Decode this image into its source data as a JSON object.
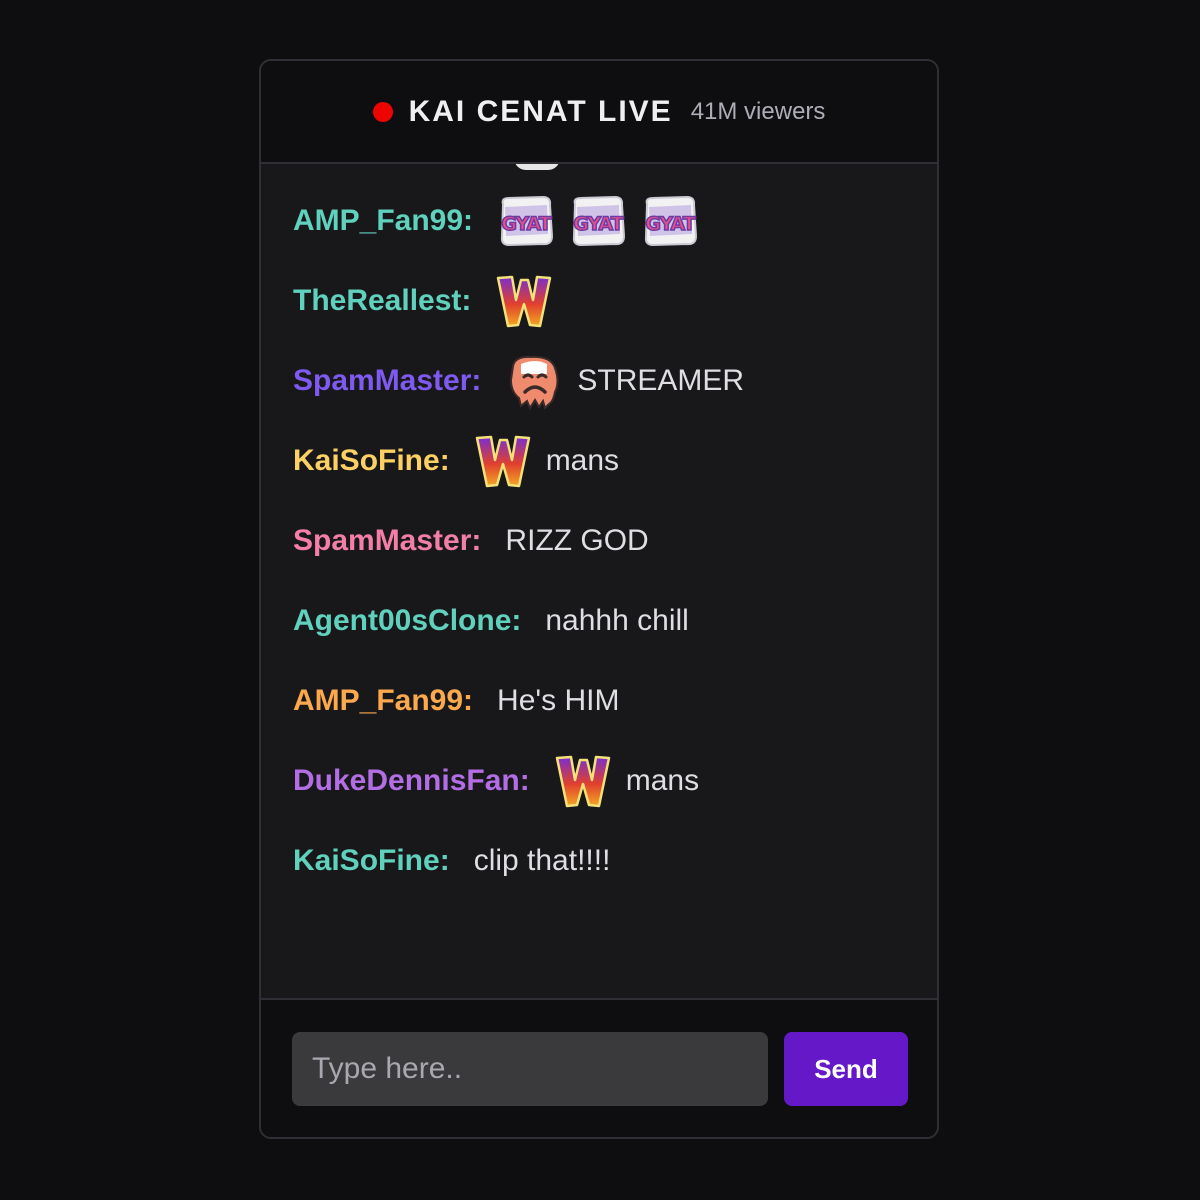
{
  "header": {
    "title": "KAI CENAT LIVE",
    "viewers": "41M viewers",
    "live_dot_color": "#eb0400"
  },
  "messages": [
    {
      "user": "AMP_Fan99:",
      "color": "#5fd1bd",
      "emotes": [
        "gyat-emote",
        "gyat-emote",
        "gyat-emote"
      ],
      "text": ""
    },
    {
      "user": "TheReallest:",
      "color": "#5fd1bd",
      "emotes": [
        "w-emote"
      ],
      "text": ""
    },
    {
      "user": "SpamMaster:",
      "color": "#7f5af0",
      "emotes": [
        "sad-face-emote"
      ],
      "text": "STREAMER"
    },
    {
      "user": "KaiSoFine:",
      "color": "#fcd062",
      "emotes": [
        "w-emote"
      ],
      "text": "mans"
    },
    {
      "user": "SpamMaster:",
      "color": "#f47fa6",
      "emotes": [],
      "text": "RIZZ GOD"
    },
    {
      "user": "Agent00sClone:",
      "color": "#5fd1bd",
      "emotes": [],
      "text": "nahhh chill"
    },
    {
      "user": "AMP_Fan99:",
      "color": "#fba94c",
      "emotes": [],
      "text": "He's HIM"
    },
    {
      "user": "DukeDennisFan:",
      "color": "#b36ee6",
      "emotes": [
        "w-emote"
      ],
      "text": "mans"
    },
    {
      "user": "KaiSoFine:",
      "color": "#5fd1bd",
      "emotes": [],
      "text": "clip that!!!!"
    }
  ],
  "input": {
    "placeholder": "Type here..",
    "value": ""
  },
  "send_button": {
    "label": "Send",
    "color": "#6418c8"
  }
}
